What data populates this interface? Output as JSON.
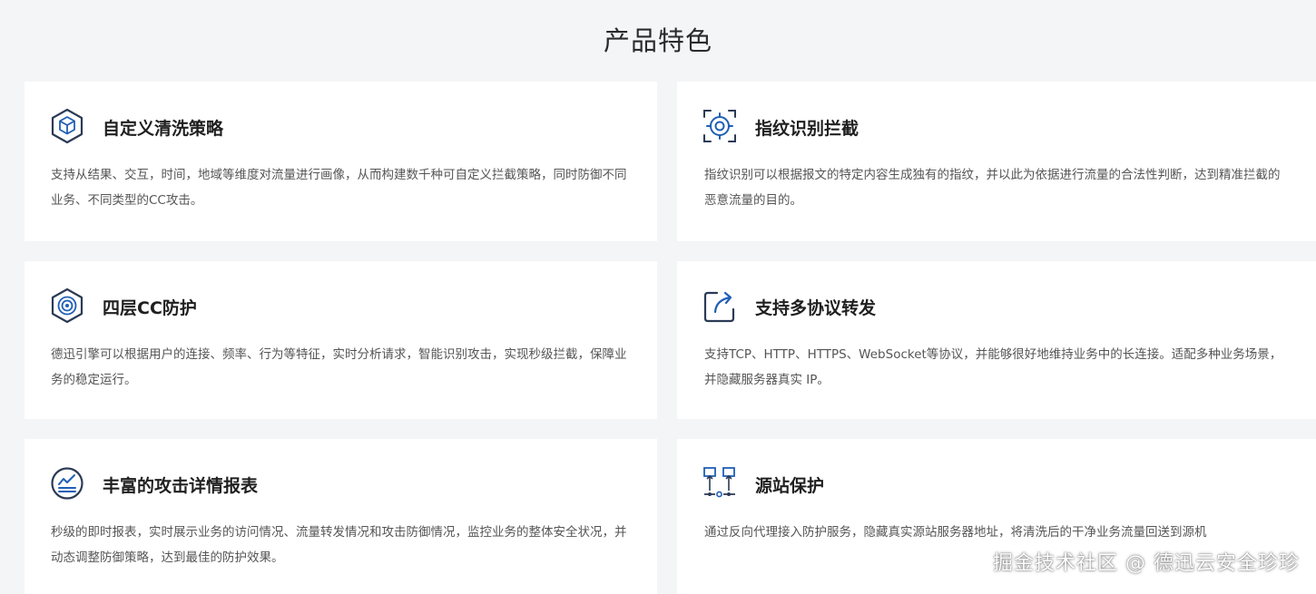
{
  "section": {
    "title": "产品特色"
  },
  "features": [
    {
      "title": "自定义清洗策略",
      "icon": "cube-icon",
      "description": "支持从结果、交互，时间，地域等维度对流量进行画像，从而构建数千种可自定义拦截策略，同时防御不同业务、不同类型的CC攻击。"
    },
    {
      "title": "指纹识别拦截",
      "icon": "crosshair-icon",
      "description": "指纹识别可以根据报文的特定内容生成独有的指纹，并以此为依据进行流量的合法性判断，达到精准拦截的恶意流量的目的。"
    },
    {
      "title": "四层CC防护",
      "icon": "shield-target-icon",
      "description": "德迅引擎可以根据用户的连接、频率、行为等特征，实时分析请求，智能识别攻击，实现秒级拦截，保障业务的稳定运行。"
    },
    {
      "title": "支持多协议转发",
      "icon": "share-arrow-icon",
      "description": "支持TCP、HTTP、HTTPS、WebSocket等协议，并能够很好地维持业务中的长连接。适配多种业务场景，并隐藏服务器真实 IP。"
    },
    {
      "title": "丰富的攻击详情报表",
      "icon": "report-chart-icon",
      "description": "秒级的即时报表，实时展示业务的访问情况、流量转发情况和攻击防御情况，监控业务的整体安全状况，并动态调整防御策略，达到最佳的防护效果。"
    },
    {
      "title": "源站保护",
      "icon": "server-link-icon",
      "description": "通过反向代理接入防护服务，隐藏真实源站服务器地址，将清洗后的干净业务流量回送到源机"
    }
  ],
  "watermark": {
    "text": "掘金技术社区 @ 德迅云安全珍珍"
  },
  "colors": {
    "accent": "#1f5fb5",
    "icon_dark": "#2b3a55",
    "background": "#f4f5f7",
    "card": "#ffffff"
  }
}
